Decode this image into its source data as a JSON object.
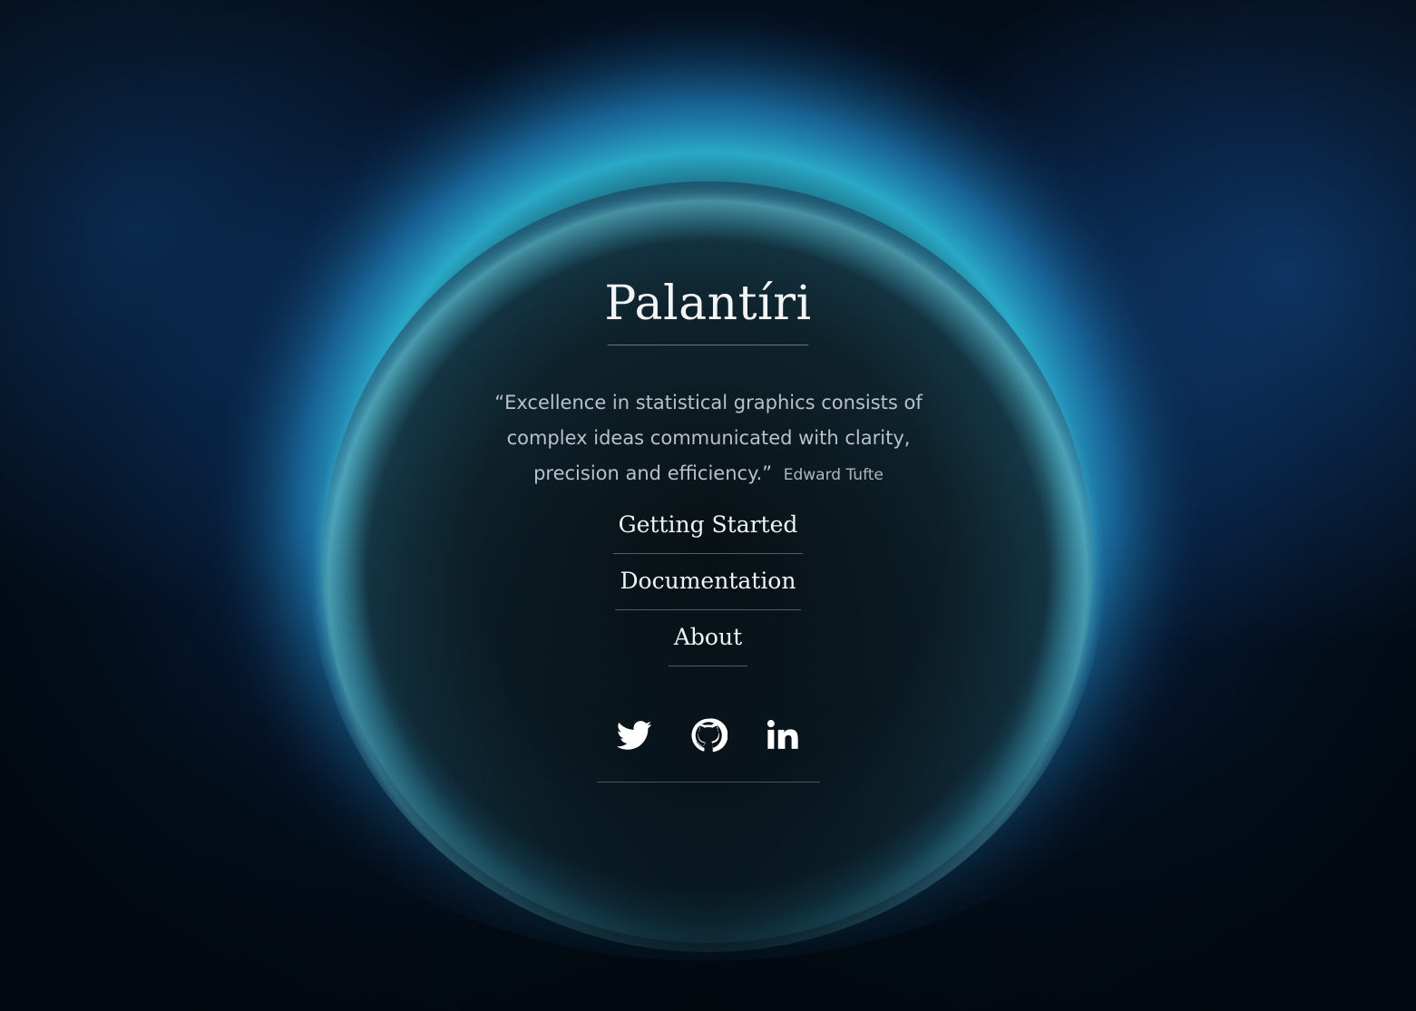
{
  "site": {
    "title": "Palantíri"
  },
  "quote": {
    "text": "“Excellence in statistical graphics consists of complex ideas communicated with clarity, precision and efficiency.”",
    "author": "Edward Tufte"
  },
  "nav": {
    "items": [
      {
        "label": "Getting Started"
      },
      {
        "label": "Documentation"
      },
      {
        "label": "About"
      }
    ]
  },
  "social": {
    "links": [
      {
        "icon": "twitter-icon"
      },
      {
        "icon": "github-icon"
      },
      {
        "icon": "linkedin-icon"
      }
    ]
  },
  "colors": {
    "background": "#030b14",
    "glow": "#3fc3d8",
    "text": "#f0f3f6"
  }
}
